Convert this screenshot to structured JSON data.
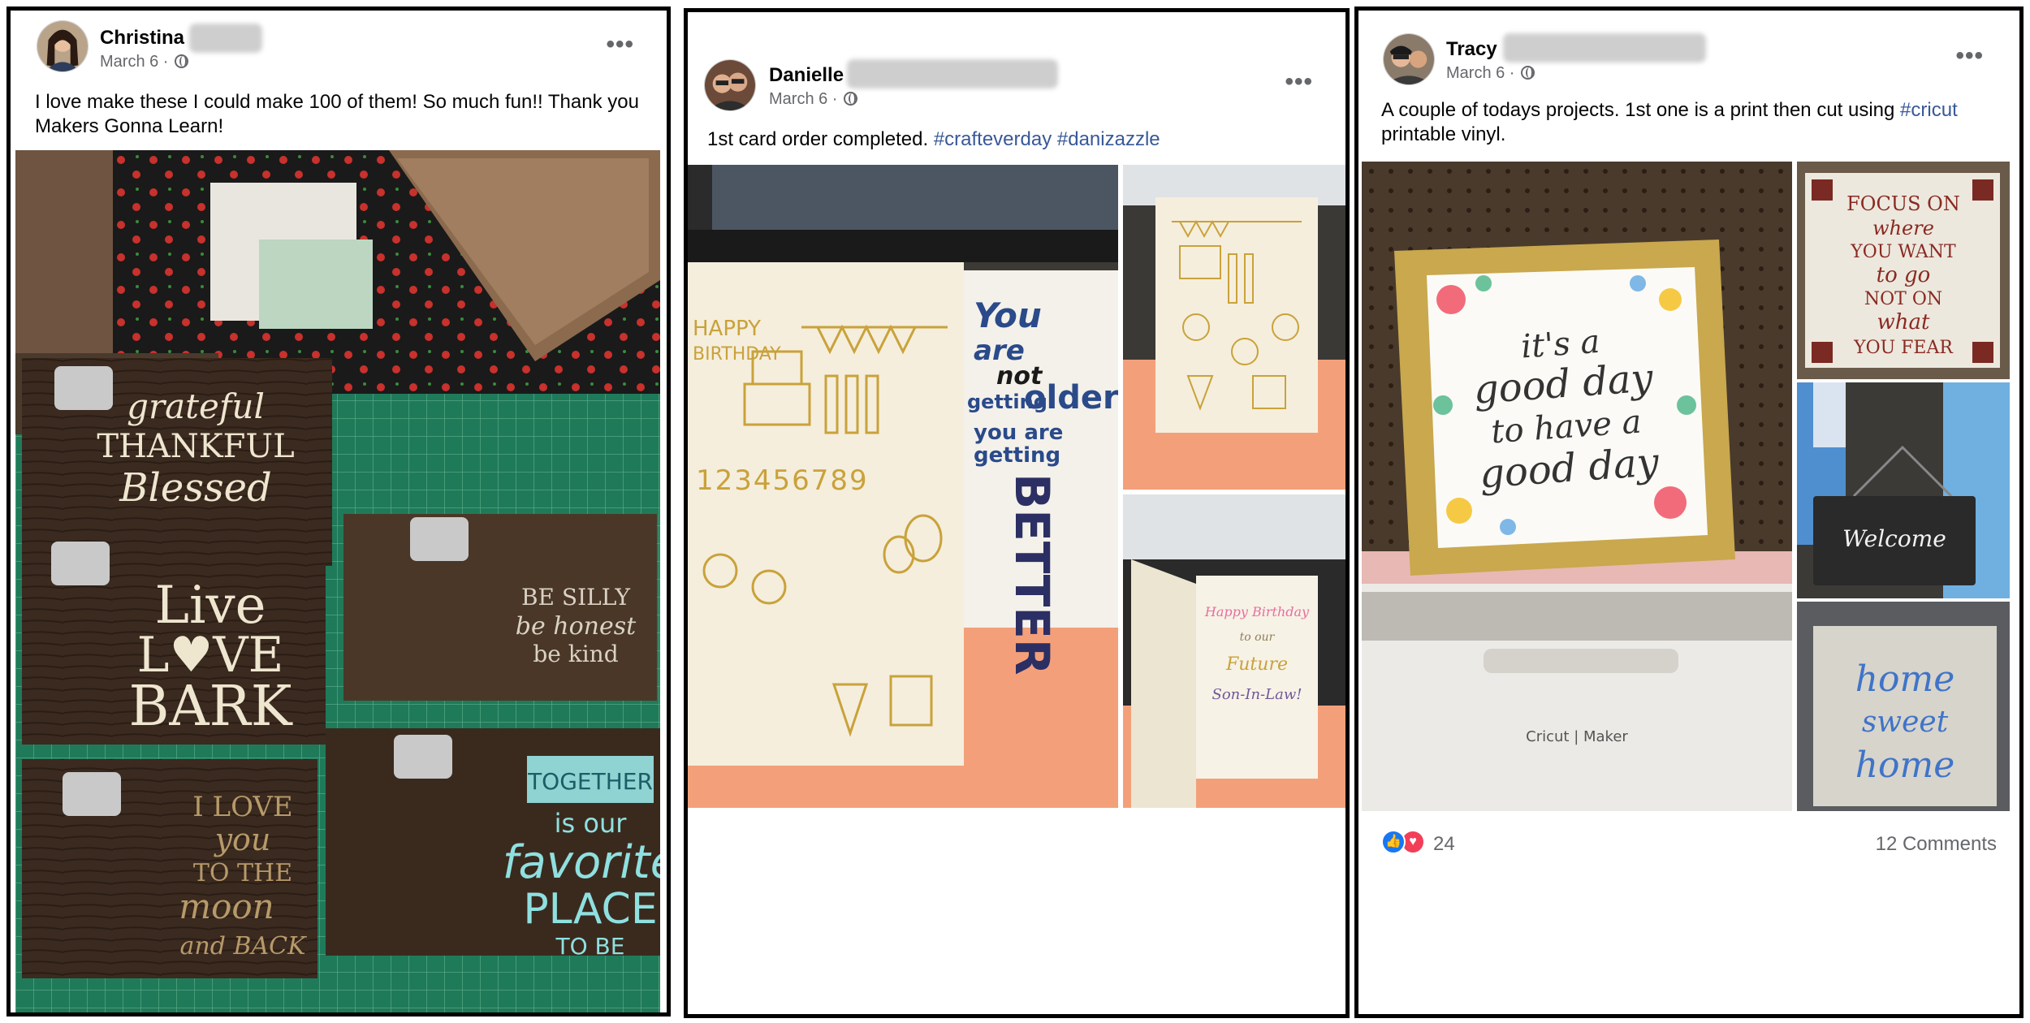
{
  "posts": [
    {
      "author": "Christina",
      "date": "March 6 ·",
      "text": "I love make these I could make 100 of them!  So much fun!! Thank you Makers Gonna Learn!",
      "images": [
        {
          "alt": "Wooden clipboard signs on a cutting mat",
          "signs": [
            "grateful",
            "THANKFUL",
            "Blessed",
            "Live",
            "L♥VE",
            "BARK",
            "BE SILLY",
            "be honest",
            "be kind",
            "I LOVE",
            "you",
            "TO THE",
            "moon",
            "and BACK",
            "TOGETHER",
            "is our",
            "favorite",
            "PLACE",
            "TO BE"
          ]
        }
      ]
    },
    {
      "author": "Danielle",
      "date": "March 6 ·",
      "text_plain": "1st card order completed. ",
      "hashtags": [
        "#crafteverday",
        "#danizazzle"
      ],
      "images": [
        {
          "alt": "Birthday cards on orange table",
          "signs": [
            "You",
            "are",
            "not",
            "getting",
            "older",
            "you are",
            "getting",
            "BETTER",
            "HAPPY",
            "BIRTHDAY",
            "123456789"
          ]
        },
        {
          "alt": "Gold foil birthday card"
        },
        {
          "alt": "Inside of card",
          "signs": [
            "Happy Birthday",
            "to our",
            "Future",
            "Son-In-Law!"
          ]
        }
      ]
    },
    {
      "author": "Tracy",
      "date": "March 6 ·",
      "text_plain1": "A couple of todays projects. 1st one is a print then cut using ",
      "hashtag": "#cricut",
      "text_plain2": " printable vinyl.",
      "images": [
        {
          "alt": "Framed print on Cricut Maker",
          "signs": [
            "it's a",
            "good day",
            "to have a",
            "good day",
            "Cricut | Maker"
          ]
        },
        {
          "alt": "Focus sign",
          "signs": [
            "FOCUS ON",
            "where",
            "YOU WANT",
            "to go",
            "NOT ON",
            "what",
            "YOU FEAR"
          ]
        },
        {
          "alt": "Welcome sign",
          "signs": [
            "Welcome"
          ]
        },
        {
          "alt": "Home sweet home sign",
          "signs": [
            "home",
            "sweet",
            "home"
          ]
        }
      ],
      "reactions": {
        "count": "24",
        "like_icon": "like-icon",
        "love_icon": "love-icon"
      },
      "comments": "12 Comments"
    }
  ],
  "colors": {
    "hashtag": "#385898",
    "meta": "#65676b",
    "like": "#1877f2",
    "love": "#f33e58"
  }
}
